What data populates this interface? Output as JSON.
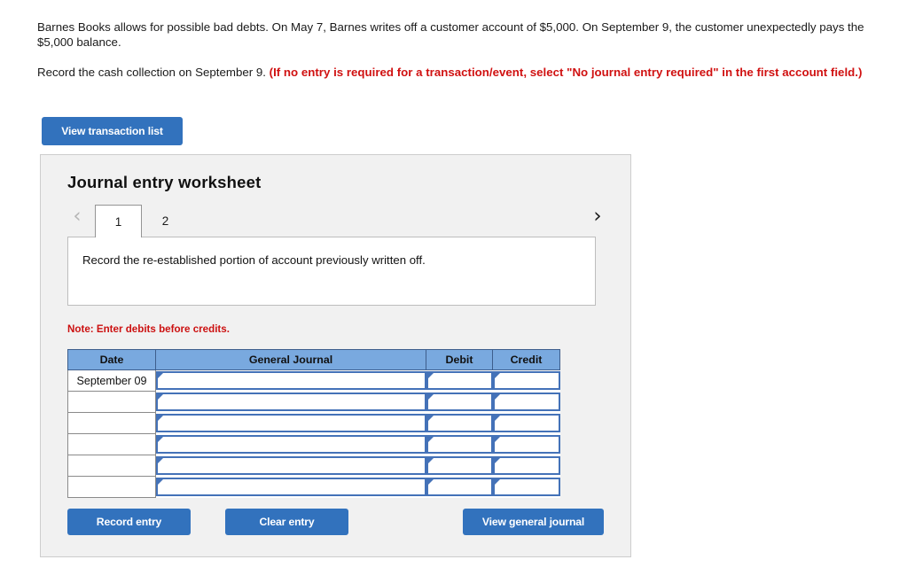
{
  "problem": {
    "scenario": "Barnes Books allows for possible bad debts. On May 7, Barnes writes off a customer account of $5,000. On September 9, the customer unexpectedly pays the $5,000 balance.",
    "requirement_lead": "Record the cash collection on September 9.",
    "requirement_note": "(If no entry is required for a transaction/event, select \"No journal entry required\" in the first account field.)"
  },
  "toolbar": {
    "view_transaction_list_label": "View transaction list"
  },
  "worksheet": {
    "title": "Journal entry worksheet",
    "prev_icon": "‹",
    "next_icon": "›",
    "tabs": [
      {
        "label": "1",
        "active": true
      },
      {
        "label": "2",
        "active": false
      }
    ],
    "instruction": "Record the re-established portion of account previously written off.",
    "note": "Note: Enter debits before credits."
  },
  "table": {
    "columns": [
      "Date",
      "General Journal",
      "Debit",
      "Credit"
    ],
    "rows": [
      {
        "date": "September 09",
        "general_journal": "",
        "debit": "",
        "credit": ""
      },
      {
        "date": "",
        "general_journal": "",
        "debit": "",
        "credit": ""
      },
      {
        "date": "",
        "general_journal": "",
        "debit": "",
        "credit": ""
      },
      {
        "date": "",
        "general_journal": "",
        "debit": "",
        "credit": ""
      },
      {
        "date": "",
        "general_journal": "",
        "debit": "",
        "credit": ""
      },
      {
        "date": "",
        "general_journal": "",
        "debit": "",
        "credit": ""
      }
    ]
  },
  "actions": {
    "record_entry_label": "Record entry",
    "clear_entry_label": "Clear entry",
    "view_general_journal_label": "View general journal"
  },
  "colors": {
    "button_blue": "#3272bd",
    "table_header_blue": "#79a9df",
    "field_border_blue": "#4472b8",
    "alert_red": "#d01111",
    "panel_gray": "#f1f1f1"
  }
}
